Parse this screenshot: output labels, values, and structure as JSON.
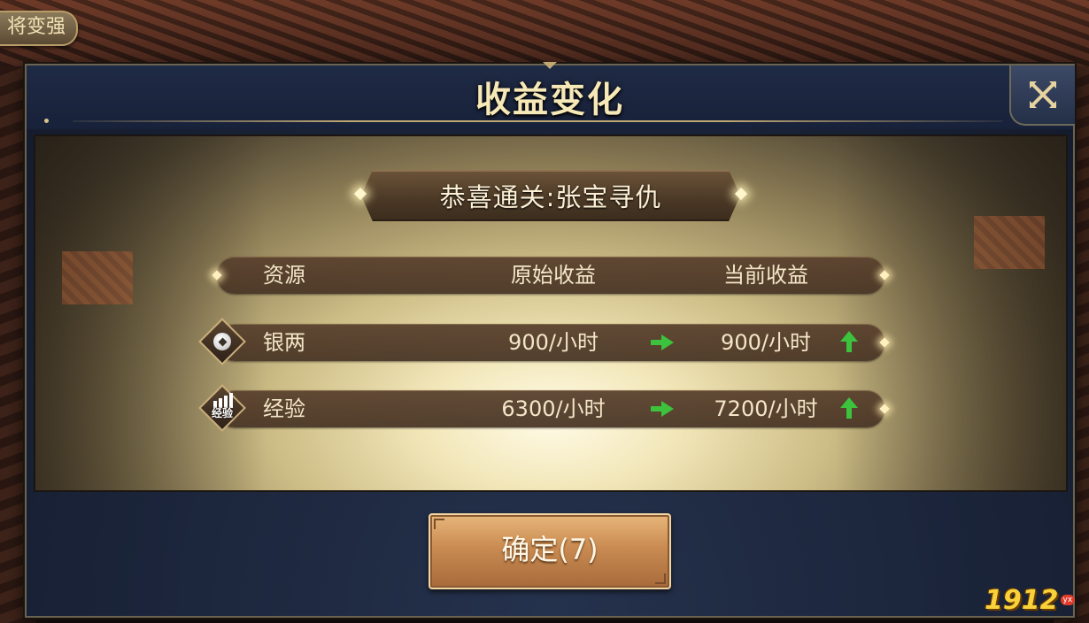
{
  "top_tab": {
    "label": "将变强"
  },
  "dialog": {
    "title": "收益变化",
    "close_icon": "close-x-icon",
    "banner": "恭喜通关:张宝寻仇",
    "table": {
      "headers": [
        "资源",
        "原始收益",
        "当前收益"
      ],
      "rows": [
        {
          "icon": "silver-coin-icon",
          "name": "银两",
          "original": "900/小时",
          "current": "900/小时"
        },
        {
          "icon": "experience-icon",
          "icon_text": "经验",
          "name": "经验",
          "original": "6300/小时",
          "current": "7200/小时"
        }
      ]
    },
    "confirm_label": "确定(7)"
  },
  "watermark": {
    "text": "1912",
    "badge": "yx"
  },
  "colors": {
    "accent_green": "#3cc23c",
    "title_gold": "#f6e8b7",
    "button": "#c98b52"
  }
}
